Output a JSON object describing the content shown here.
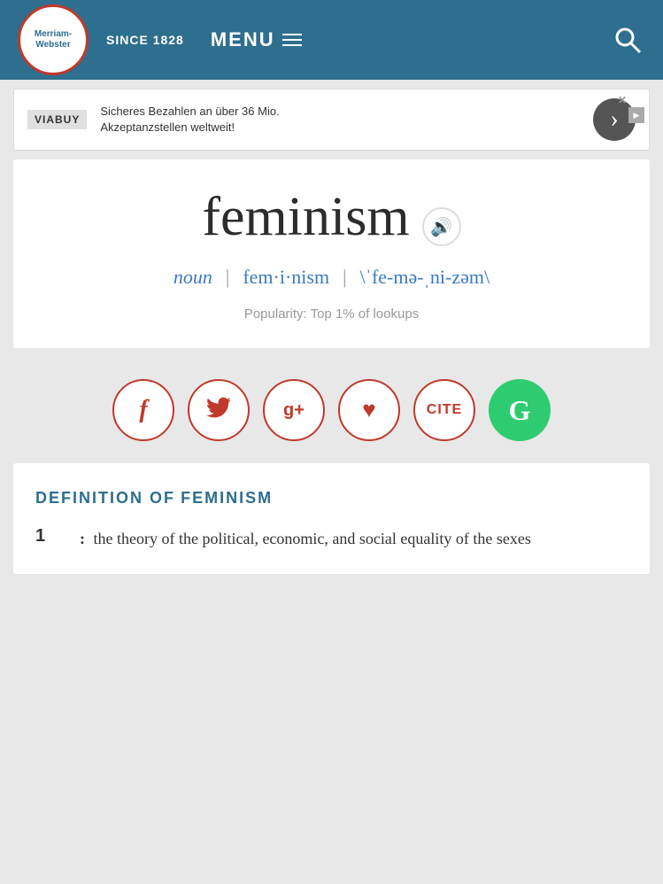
{
  "header": {
    "logo_line1": "Merriam-",
    "logo_line2": "Webster",
    "since": "SINCE 1828",
    "menu_label": "MENU",
    "search_label": "Search"
  },
  "ad": {
    "brand": "VIABUY",
    "text_line1": "Sicheres Bezahlen an über 36 Mio.",
    "text_line2": "Akzeptanzstellen weltweit!",
    "arrow_label": "›",
    "close_label": "✕",
    "ad_info": "▶"
  },
  "word": {
    "title": "feminism",
    "speaker_icon": "🔊",
    "part_of_speech": "noun",
    "syllables": "fem·i·nism",
    "pronunciation": "\\ˈfe-mə-ˌni-zəm\\",
    "popularity": "Popularity: Top 1% of lookups"
  },
  "actions": {
    "facebook_label": "f",
    "twitter_label": "🐦",
    "googleplus_label": "g+",
    "favorite_label": "♥",
    "cite_label": "CITE",
    "grammarly_label": "G"
  },
  "definition": {
    "title_prefix": "Definition of",
    "title_word": "FEMINISM",
    "entry1_number": "1",
    "entry1_colon": ":",
    "entry1_text": " the theory of the political, economic, and social equality of the sexes"
  }
}
